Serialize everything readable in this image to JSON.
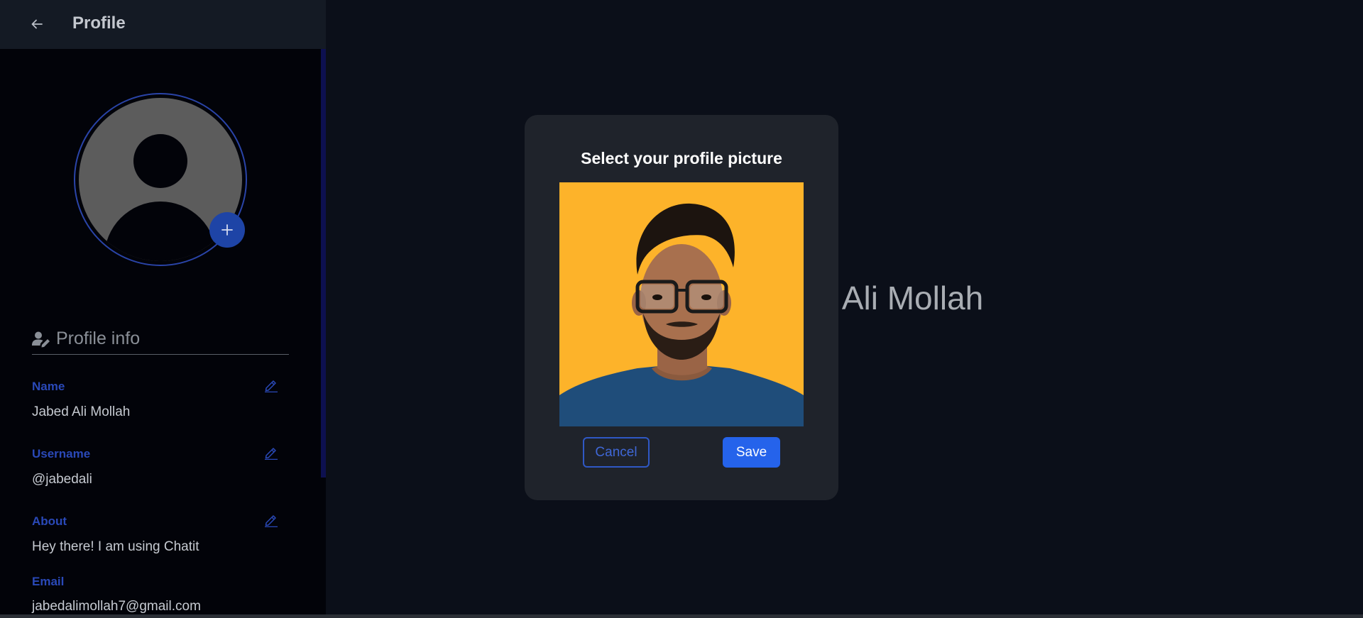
{
  "header": {
    "title": "Profile"
  },
  "profile": {
    "section_title": "Profile info",
    "fields": [
      {
        "label": "Name",
        "value": "Jabed Ali Mollah"
      },
      {
        "label": "Username",
        "value": "@jabedali"
      },
      {
        "label": "About",
        "value": "Hey there! I am using Chatit"
      },
      {
        "label": "Email",
        "value": "jabedalimollah7@gmail.com"
      }
    ]
  },
  "background": {
    "name_text": "d Ali Mollah"
  },
  "modal": {
    "title": "Select your profile picture",
    "cancel_label": "Cancel",
    "save_label": "Save"
  },
  "colors": {
    "accent": "#2563eb",
    "label_blue": "#2a49b8",
    "modal_bg": "#1f232b",
    "photo_bg": "#fdb32a"
  },
  "icons": {
    "back": "arrow-left-icon",
    "add": "plus-icon",
    "section": "user-edit-icon",
    "edit": "pencil-icon"
  }
}
